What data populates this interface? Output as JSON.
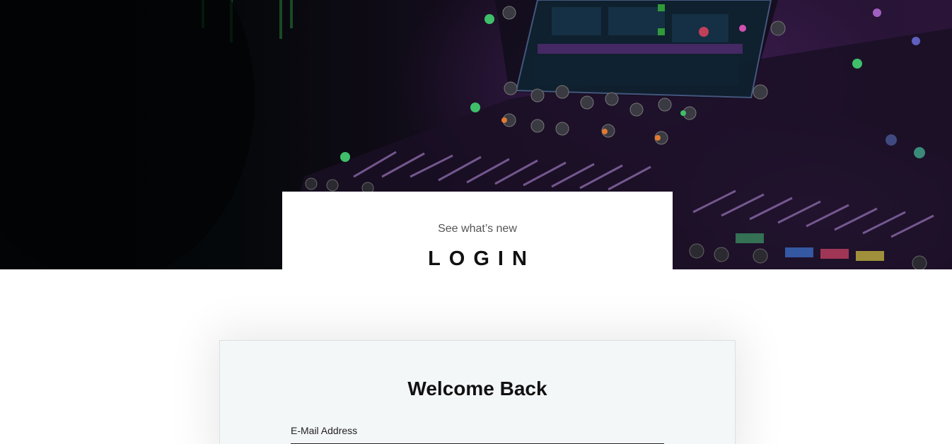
{
  "hero": {
    "subtitle": "See what’s new",
    "title": "LOGIN"
  },
  "login": {
    "heading": "Welcome Back",
    "email_label": "E-Mail Address",
    "email_value": ""
  },
  "colors": {
    "hero_dark": "#05080a",
    "hero_purple": "#2a1538",
    "card_background": "#f4f7f8",
    "text_dark": "#111111",
    "text_muted": "#555555"
  }
}
